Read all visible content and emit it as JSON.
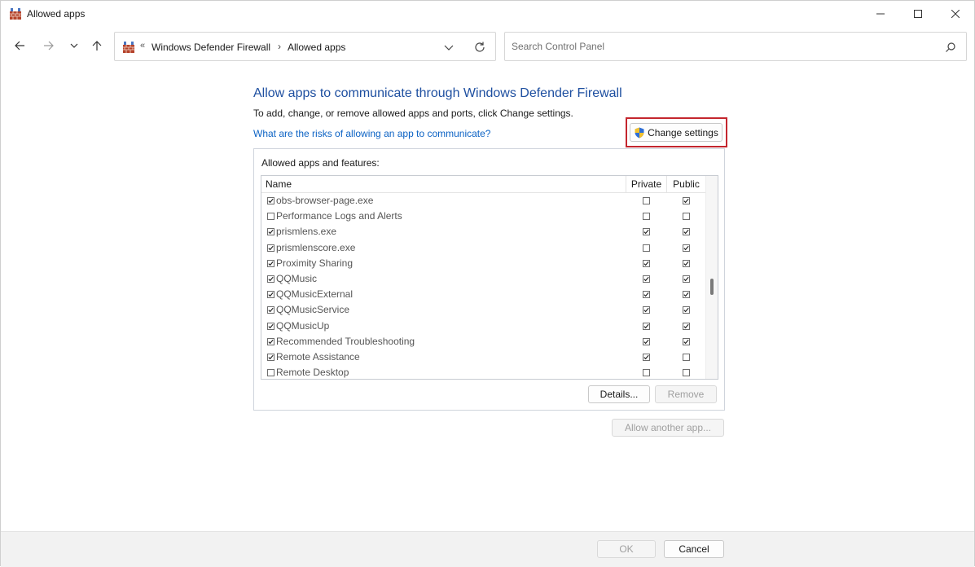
{
  "window": {
    "title": "Allowed apps",
    "icon": "firewall-icon"
  },
  "nav": {
    "breadcrumb": [
      "Windows Defender Firewall",
      "Allowed apps"
    ],
    "overflow_glyph": "«",
    "separator": "›",
    "search_placeholder": "Search Control Panel"
  },
  "content": {
    "heading": "Allow apps to communicate through Windows Defender Firewall",
    "subtext": "To add, change, or remove allowed apps and ports, click Change settings.",
    "risk_link": "What are the risks of allowing an app to communicate?",
    "change_settings_label": "Change settings",
    "panel_label": "Allowed apps and features:",
    "columns": {
      "name": "Name",
      "private": "Private",
      "public": "Public"
    },
    "apps": [
      {
        "name": "obs-browser-page.exe",
        "enabled": true,
        "private": false,
        "public": true
      },
      {
        "name": "Performance Logs and Alerts",
        "enabled": false,
        "private": false,
        "public": false
      },
      {
        "name": "prismlens.exe",
        "enabled": true,
        "private": true,
        "public": true
      },
      {
        "name": "prismlenscore.exe",
        "enabled": true,
        "private": false,
        "public": true
      },
      {
        "name": "Proximity Sharing",
        "enabled": true,
        "private": true,
        "public": true
      },
      {
        "name": "QQMusic",
        "enabled": true,
        "private": true,
        "public": true
      },
      {
        "name": "QQMusicExternal",
        "enabled": true,
        "private": true,
        "public": true
      },
      {
        "name": "QQMusicService",
        "enabled": true,
        "private": true,
        "public": true
      },
      {
        "name": "QQMusicUp",
        "enabled": true,
        "private": true,
        "public": true
      },
      {
        "name": "Recommended Troubleshooting",
        "enabled": true,
        "private": true,
        "public": true
      },
      {
        "name": "Remote Assistance",
        "enabled": true,
        "private": true,
        "public": false
      },
      {
        "name": "Remote Desktop",
        "enabled": false,
        "private": false,
        "public": false
      }
    ],
    "details_label": "Details...",
    "remove_label": "Remove",
    "allow_another_label": "Allow another app..."
  },
  "footer": {
    "ok_label": "OK",
    "cancel_label": "Cancel"
  },
  "colors": {
    "heading": "#1e4fa0",
    "link": "#0b62c4",
    "highlight_outline": "#c4262e"
  }
}
